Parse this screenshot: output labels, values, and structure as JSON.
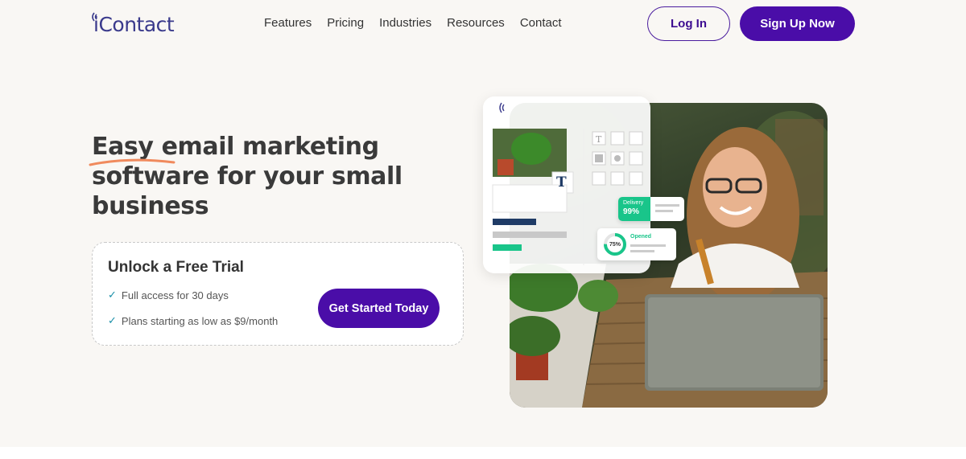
{
  "brand": {
    "logo_text": "iContact",
    "primary_color": "#4a0da8",
    "accent_color": "#19c58a"
  },
  "nav": {
    "links": [
      "Features",
      "Pricing",
      "Industries",
      "Resources",
      "Contact"
    ],
    "login_label": "Log In",
    "signup_label": "Sign Up Now"
  },
  "hero": {
    "headline_line1": "Easy email marketing",
    "headline_line2": "software for your small",
    "headline_line3": "business"
  },
  "trial": {
    "title": "Unlock a Free Trial",
    "items": [
      "Full access for 30 days",
      "Plans starting as low as $9/month"
    ],
    "cta_label": "Get Started Today"
  },
  "stats": {
    "delivery_label": "Delivery",
    "delivery_value": "99%",
    "opened_label": "Opened",
    "opened_value": "75%",
    "opened_fraction": 0.75
  },
  "editor": {
    "text_tool_glyph": "T"
  }
}
